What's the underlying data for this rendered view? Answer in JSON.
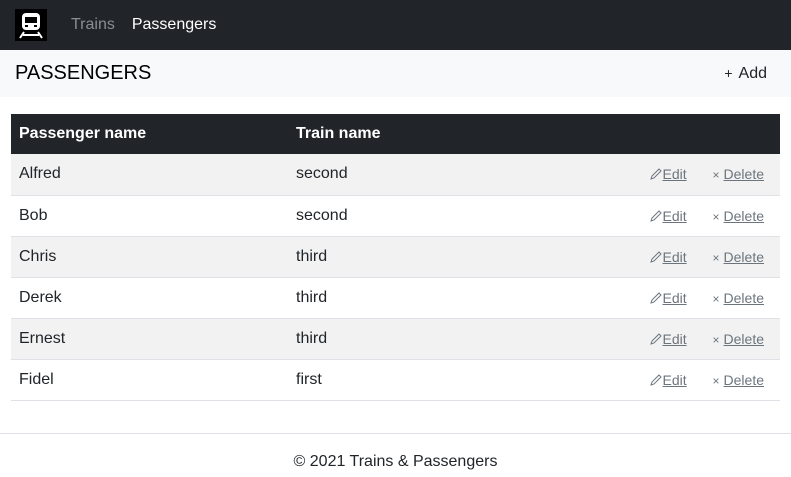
{
  "nav": {
    "brand_icon": "train-icon",
    "links": [
      {
        "label": "Trains"
      },
      {
        "label": "Passengers"
      }
    ]
  },
  "header": {
    "title": "PASSENGERS",
    "add_label": "Add"
  },
  "table": {
    "columns": [
      "Passenger name",
      "Train name"
    ],
    "edit_label": "Edit",
    "delete_label": "Delete",
    "rows": [
      {
        "name": "Alfred",
        "train": "second"
      },
      {
        "name": "Bob",
        "train": "second"
      },
      {
        "name": "Chris",
        "train": "third"
      },
      {
        "name": "Derek",
        "train": "third"
      },
      {
        "name": "Ernest",
        "train": "third"
      },
      {
        "name": "Fidel",
        "train": "first"
      }
    ]
  },
  "footer": {
    "text": "© 2021 Trains & Passengers"
  }
}
